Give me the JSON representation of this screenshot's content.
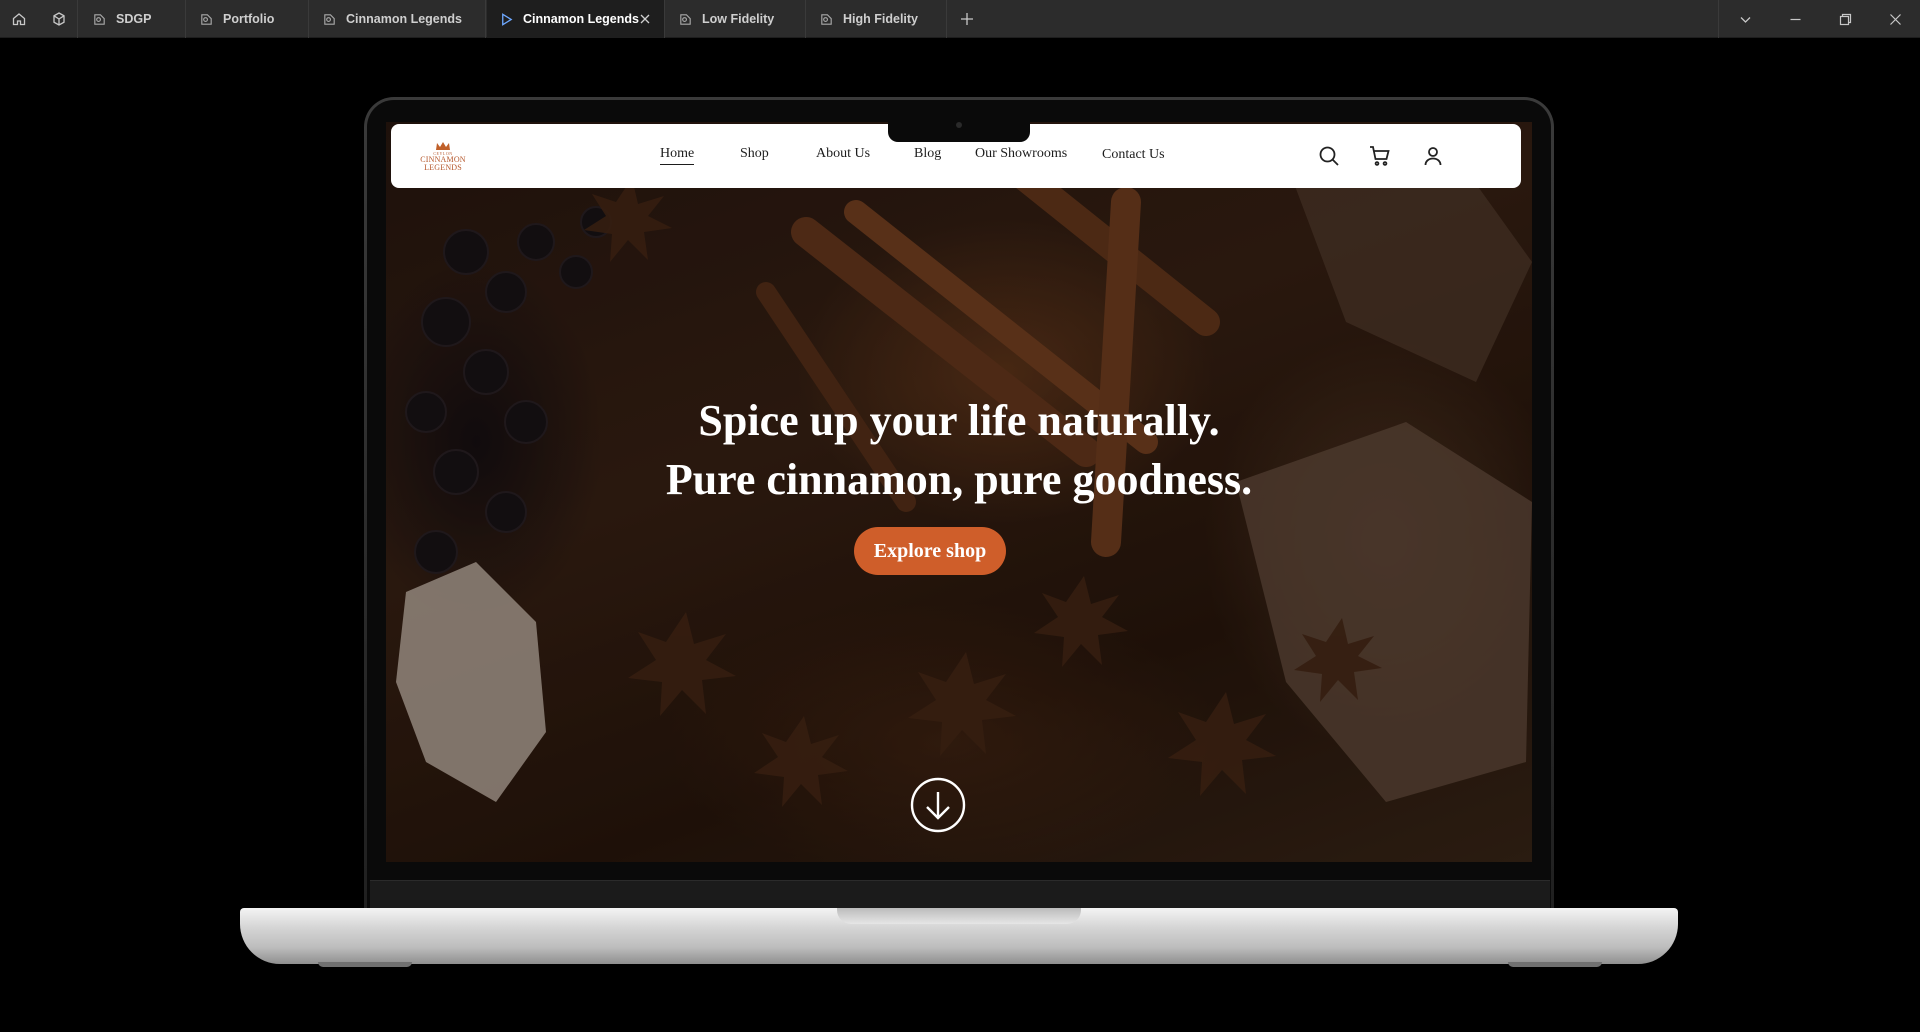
{
  "window": {
    "tabs": [
      {
        "label": "SDGP",
        "icon": "figma-file-icon",
        "active": false
      },
      {
        "label": "Portfolio",
        "icon": "figma-file-icon",
        "active": false
      },
      {
        "label": "Cinnamon Legends",
        "icon": "figma-file-icon",
        "active": false
      },
      {
        "label": "Cinnamon Legends",
        "icon": "play-prototype-icon",
        "active": true
      },
      {
        "label": "Low Fidelity",
        "icon": "figma-file-icon",
        "active": false
      },
      {
        "label": "High Fidelity",
        "icon": "figma-file-icon",
        "active": false
      }
    ]
  },
  "site": {
    "logo": {
      "small": "CEYLON",
      "line1": "CINNAMON",
      "line2": "LEGENDS",
      "color": "#b5562a"
    },
    "nav": [
      "Home",
      "Shop",
      "About Us",
      "Blog",
      "Our Showrooms",
      "Contact Us"
    ],
    "hero": {
      "line1": "Spice up your life naturally.",
      "line2": "Pure cinnamon, pure goodness.",
      "cta": "Explore shop",
      "cta_color": "#cf5e2a"
    }
  }
}
